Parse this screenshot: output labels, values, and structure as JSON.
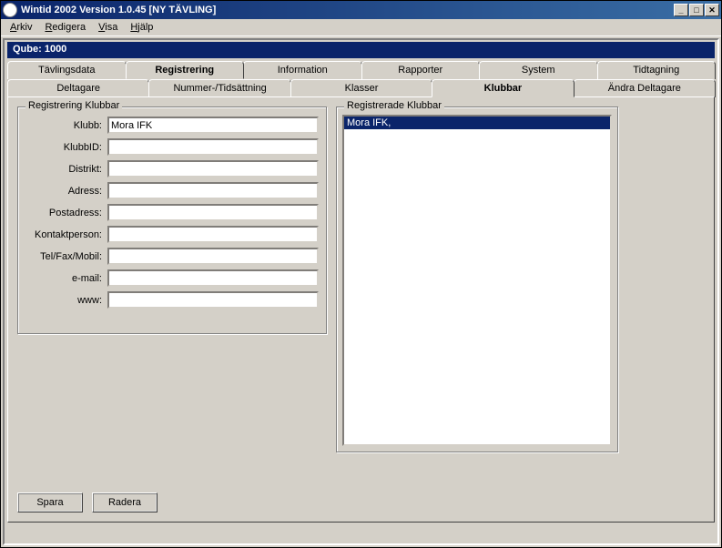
{
  "window": {
    "title": "Wintid 2002   Version 1.0.45 [NY TÄVLING]"
  },
  "menu": {
    "arkiv": "Arkiv",
    "redigera": "Redigera",
    "visa": "Visa",
    "hjalp": "Hjälp"
  },
  "qube": {
    "label": "Qube: 1000"
  },
  "tabs_main": {
    "tavlingsdata": "Tävlingsdata",
    "registrering": "Registrering",
    "information": "Information",
    "rapporter": "Rapporter",
    "system": "System",
    "tidtagning": "Tidtagning"
  },
  "tabs_sub": {
    "deltagare": "Deltagare",
    "nummer": "Nummer-/Tidsättning",
    "klasser": "Klasser",
    "klubbar": "Klubbar",
    "andra": "Ändra Deltagare"
  },
  "group_left": {
    "legend": "Registrering Klubbar",
    "labels": {
      "klubb": "Klubb:",
      "klubbid": "KlubbID:",
      "distrikt": "Distrikt:",
      "adress": "Adress:",
      "postadress": "Postadress:",
      "kontakt": "Kontaktperson:",
      "tel": "Tel/Fax/Mobil:",
      "email": "e-mail:",
      "www": "www:"
    },
    "values": {
      "klubb": "Mora IFK",
      "klubbid": "",
      "distrikt": "",
      "adress": "",
      "postadress": "",
      "kontakt": "",
      "tel": "",
      "email": "",
      "www": ""
    }
  },
  "group_right": {
    "legend": "Registrerade Klubbar",
    "items": {
      "0": "Mora IFK,"
    }
  },
  "buttons": {
    "spara": "Spara",
    "radera": "Radera"
  }
}
